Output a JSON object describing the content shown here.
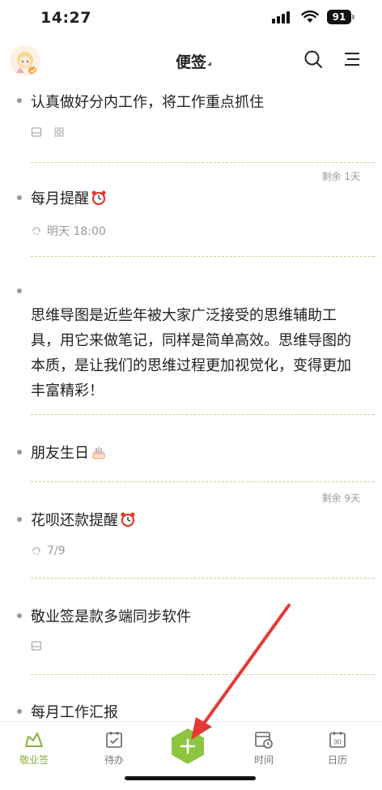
{
  "status_bar": {
    "time": "14:27",
    "battery": "91"
  },
  "header": {
    "title": "便签"
  },
  "notes": [
    {
      "title": "认真做好分内工作，将工作重点抓住"
    },
    {
      "remaining": "剩余 1天",
      "title": "每月提醒",
      "reminder": "明天 18:00"
    },
    {
      "body": "思维导图是近些年被大家广泛接受的思维辅助工具，用它来做笔记，同样是简单高效。思维导图的本质，是让我们的思维过程更加视觉化，变得更加丰富精彩！"
    },
    {
      "title": "朋友生日"
    },
    {
      "remaining": "剩余 9天",
      "title": "花呗还款提醒",
      "reminder": "7/9"
    },
    {
      "title": "敬业签是款多端同步软件"
    },
    {
      "title": "每月工作汇报"
    }
  ],
  "tabbar": {
    "tabs": [
      {
        "label": "敬业签"
      },
      {
        "label": "待办"
      },
      {
        "label": "时间"
      },
      {
        "label": "日历"
      }
    ],
    "calendar_day": "30"
  },
  "colors": {
    "accent": "#8ab13a",
    "fab": "#8cc63f",
    "arrow": "#e53935"
  }
}
